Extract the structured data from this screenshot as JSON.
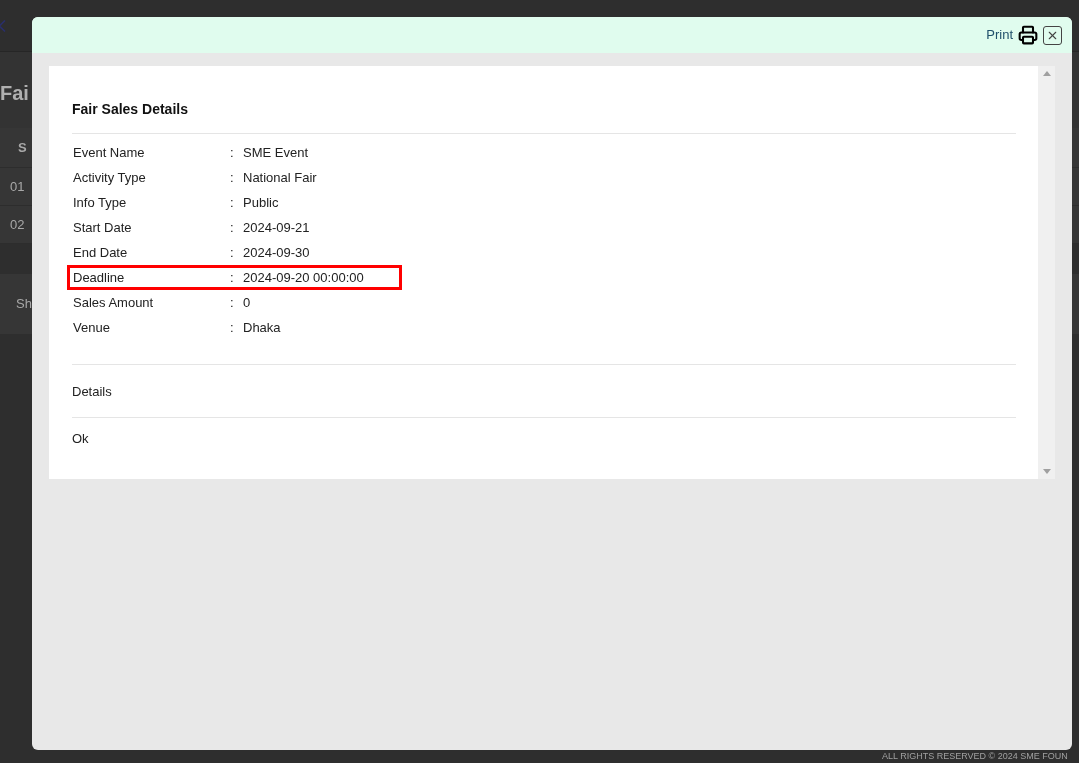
{
  "background_page": {
    "heading": "Fai",
    "table_header": "S",
    "table_rows": [
      "01",
      "02"
    ],
    "below_table": "Sh",
    "footer": "ALL RIGHTS RESERVED © 2024 SME FOUN"
  },
  "modal": {
    "print_label": "Print",
    "title": "Fair Sales Details",
    "fields": [
      {
        "label": "Event Name",
        "separator": ":",
        "value": "SME Event",
        "highlighted": false
      },
      {
        "label": "Activity Type",
        "separator": ":",
        "value": "National Fair",
        "highlighted": false
      },
      {
        "label": "Info Type",
        "separator": ":",
        "value": "Public",
        "highlighted": false
      },
      {
        "label": "Start Date",
        "separator": ":",
        "value": "2024-09-21",
        "highlighted": false
      },
      {
        "label": "End Date",
        "separator": ":",
        "value": "2024-09-30",
        "highlighted": false
      },
      {
        "label": "Deadline",
        "separator": ":",
        "value": "2024-09-20 00:00:00",
        "highlighted": true
      },
      {
        "label": "Sales Amount",
        "separator": ":",
        "value": "0",
        "highlighted": false
      },
      {
        "label": "Venue",
        "separator": ":",
        "value": "Dhaka",
        "highlighted": false
      }
    ],
    "sections": [
      "Details",
      "Ok"
    ]
  }
}
